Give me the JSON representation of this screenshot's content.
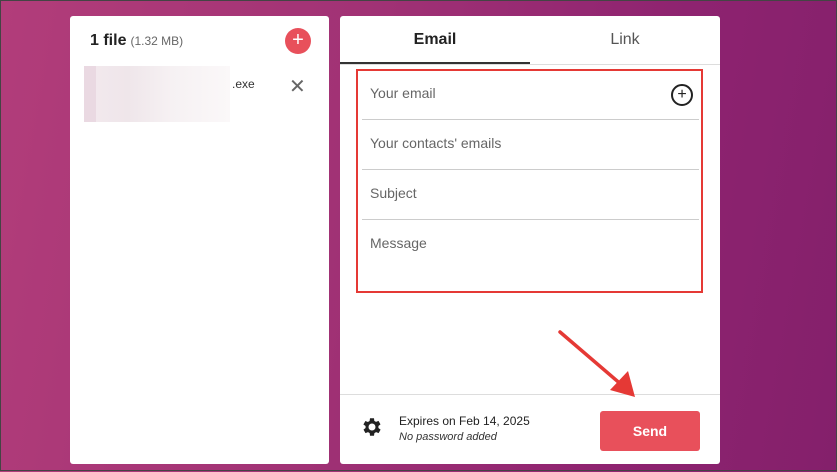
{
  "files": {
    "title": "1 file",
    "size": "(1.32 MB)",
    "add_icon": "+",
    "items": [
      {
        "name_suffix": ".exe",
        "remove_icon": "✕"
      }
    ]
  },
  "tabs": [
    {
      "label": "Email"
    },
    {
      "label": "Link"
    }
  ],
  "form": {
    "your_email_placeholder": "Your email",
    "contacts_placeholder": "Your contacts' emails",
    "subject_placeholder": "Subject",
    "message_placeholder": "Message",
    "add_icon": "+"
  },
  "footer": {
    "expires": "Expires on Feb 14, 2025",
    "password": "No password added",
    "send_label": "Send"
  },
  "colors": {
    "accent": "#e8505b",
    "highlight": "#e53935"
  }
}
